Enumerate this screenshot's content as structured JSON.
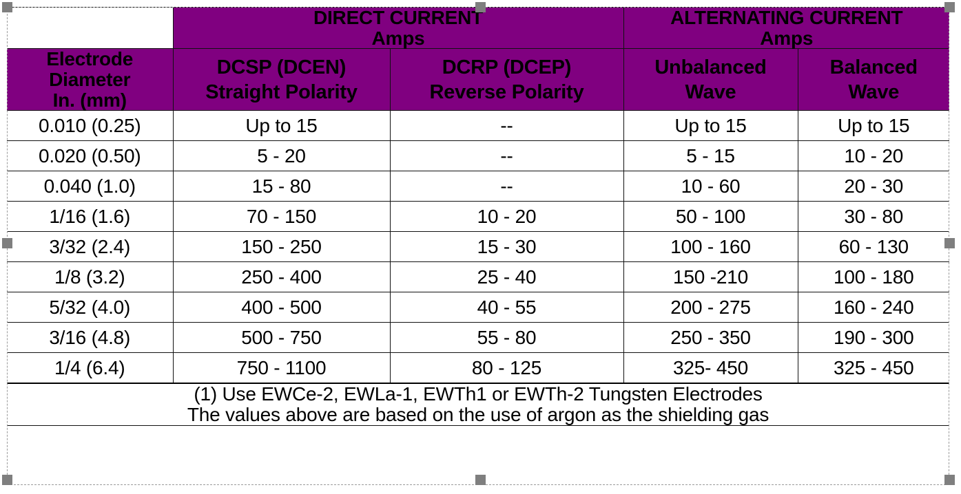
{
  "table": {
    "corner_blank": "",
    "group_headers": [
      {
        "title": "DIRECT CURRENT",
        "unit": "Amps",
        "span": 2
      },
      {
        "title": "ALTERNATING CURRENT",
        "unit": "Amps",
        "span": 2
      }
    ],
    "column_headers": [
      {
        "lines": [
          "Electrode",
          "Diameter",
          "In. (mm)"
        ]
      },
      {
        "lines": [
          "DCSP (DCEN)",
          "Straight Polarity"
        ]
      },
      {
        "lines": [
          "DCRP (DCEP)",
          "Reverse Polarity"
        ]
      },
      {
        "lines": [
          "Unbalanced",
          "Wave"
        ]
      },
      {
        "lines": [
          "Balanced",
          "Wave"
        ]
      }
    ],
    "rows": [
      {
        "diameter": "0.010 (0.25)",
        "dcsp": "Up to 15",
        "dcrp": "--",
        "unbalanced": "Up to 15",
        "balanced": "Up to 15"
      },
      {
        "diameter": "0.020 (0.50)",
        "dcsp": "5 - 20",
        "dcrp": "--",
        "unbalanced": "5 - 15",
        "balanced": "10 - 20"
      },
      {
        "diameter": "0.040 (1.0)",
        "dcsp": "15 - 80",
        "dcrp": "--",
        "unbalanced": "10 - 60",
        "balanced": "20 - 30"
      },
      {
        "diameter": "1/16 (1.6)",
        "dcsp": "70 - 150",
        "dcrp": "10 - 20",
        "unbalanced": "50 - 100",
        "balanced": "30 - 80"
      },
      {
        "diameter": "3/32 (2.4)",
        "dcsp": "150 - 250",
        "dcrp": "15 - 30",
        "unbalanced": "100 - 160",
        "balanced": "60 - 130"
      },
      {
        "diameter": "1/8 (3.2)",
        "dcsp": "250 - 400",
        "dcrp": "25 - 40",
        "unbalanced": "150 -210",
        "balanced": "100 - 180"
      },
      {
        "diameter": "5/32 (4.0)",
        "dcsp": "400 - 500",
        "dcrp": "40 - 55",
        "unbalanced": "200 - 275",
        "balanced": "160 - 240"
      },
      {
        "diameter": "3/16 (4.8)",
        "dcsp": "500 - 750",
        "dcrp": "55 - 80",
        "unbalanced": "250 - 350",
        "balanced": "190 - 300"
      },
      {
        "diameter": "1/4 (6.4)",
        "dcsp": "750 - 1100",
        "dcrp": "80 - 125",
        "unbalanced": "325- 450",
        "balanced": "325 - 450"
      }
    ],
    "footnotes": [
      "(1) Use EWCe-2, EWLa-1, EWTh1 or EWTh-2 Tungsten Electrodes",
      "The values above are based on the use of argon as the shielding gas"
    ]
  },
  "colors": {
    "header_background": "#800080",
    "header_text": "#FFFFFF",
    "grid_line": "#111111",
    "body_text": "#000000",
    "selection_handle": "#7F7F7F",
    "selection_border": "#9A9A9A"
  }
}
